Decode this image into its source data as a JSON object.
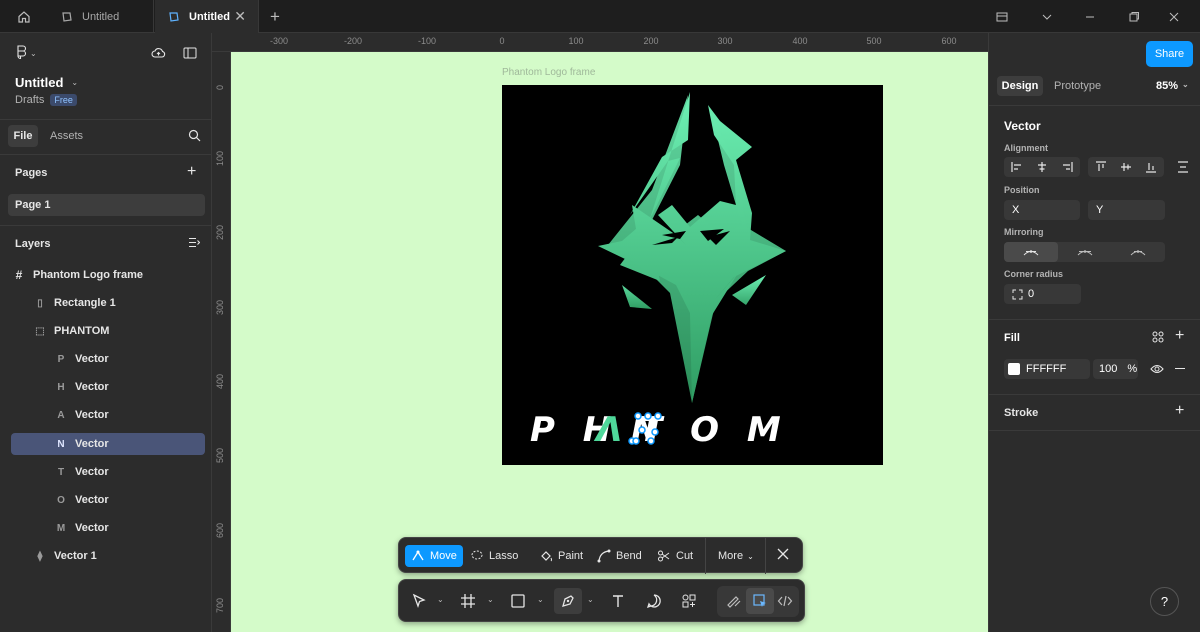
{
  "tabs": [
    {
      "label": "Untitled"
    },
    {
      "label": "Untitled"
    }
  ],
  "file": {
    "name": "Untitled",
    "location": "Drafts",
    "plan_badge": "Free"
  },
  "left_tabs": {
    "file": "File",
    "assets": "Assets"
  },
  "pages": {
    "heading": "Pages",
    "items": [
      {
        "label": "Page 1"
      }
    ]
  },
  "layers": {
    "heading": "Layers",
    "items": [
      {
        "label": "Phantom Logo frame"
      },
      {
        "label": "Rectangle 1"
      },
      {
        "label": "PHANTOM"
      },
      {
        "label": "Vector"
      },
      {
        "label": "Vector"
      },
      {
        "label": "Vector"
      },
      {
        "label": "Vector"
      },
      {
        "label": "Vector"
      },
      {
        "label": "Vector"
      },
      {
        "label": "Vector"
      },
      {
        "label": "Vector 1"
      }
    ]
  },
  "rulers": {
    "top": [
      "-300",
      "-200",
      "-100",
      "0",
      "100",
      "200",
      "300",
      "400",
      "500",
      "600"
    ],
    "left": [
      "0",
      "100",
      "200",
      "300",
      "400",
      "500",
      "600",
      "700"
    ]
  },
  "canvas": {
    "background": "#d4fbc9",
    "frame_label": "Phantom Logo frame",
    "logo_text": "PHANTOM",
    "accent": "#4fd79a"
  },
  "vector_toolbar": {
    "move": "Move",
    "lasso": "Lasso",
    "paint": "Paint",
    "bend": "Bend",
    "cut": "Cut",
    "more": "More"
  },
  "right": {
    "share": "Share",
    "tabs": {
      "design": "Design",
      "prototype": "Prototype"
    },
    "zoom": "85%",
    "section_title": "Vector",
    "alignment": "Alignment",
    "position": "Position",
    "x_label": "X",
    "y_label": "Y",
    "mirroring": "Mirroring",
    "corner_radius": "Corner radius",
    "corner_value": "0",
    "fill": {
      "heading": "Fill",
      "hex": "FFFFFF",
      "opacity": "100",
      "unit": "%"
    },
    "stroke": "Stroke"
  },
  "help": "?"
}
